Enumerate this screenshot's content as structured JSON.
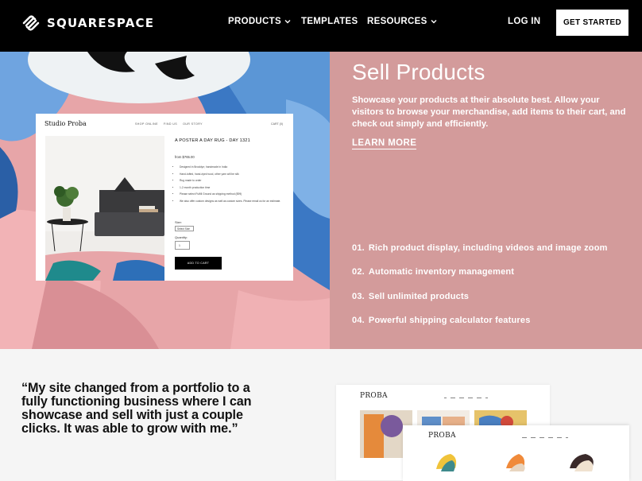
{
  "nav": {
    "logo_text": "SQUARESPACE",
    "products": "PRODUCTS",
    "templates": "TEMPLATES",
    "resources": "RESOURCES",
    "login": "LOG IN",
    "cta": "GET STARTED"
  },
  "hero": {
    "title": "Sell Products",
    "description": "Showcase your products at their absolute best. Allow your visitors to browse your merchandise, add items to their cart, and check out simply and efficiently.",
    "learn_more": "LEARN MORE",
    "features": [
      {
        "num": "01.",
        "text": "Rich product display, including videos and image zoom"
      },
      {
        "num": "02.",
        "text": "Automatic inventory management"
      },
      {
        "num": "03.",
        "text": "Sell unlimited products"
      },
      {
        "num": "04.",
        "text": "Powerful shipping calculator features"
      }
    ]
  },
  "mock": {
    "brand": "Studio Proba",
    "nav": [
      "SHOP ONLINE",
      "FIND US",
      "OUR STORY"
    ],
    "cart": "CART (0)",
    "product_title": "A POSTER A DAY RUG - DAY 1321",
    "price": "from $765.00",
    "bullets": [
      "Designed in Brooklyn; handmade in India",
      "Hand-tufted, hand-dyed wool, other yarn will be silk",
      "Rug made to order",
      "1-2 month production time",
      "Please select Fulfill Ground as shipping method ($99)",
      "We also offer custom designs as well as custom sizes. Please email us for an estimate."
    ],
    "size_label": "Size:",
    "size_value": "Select Size",
    "qty_label": "Quantity:",
    "qty_value": "1",
    "add_button": "ADD TO CART"
  },
  "testimonial": {
    "quote": "“My site changed from a portfolio to a fully functioning business where I can showcase and sell with just a couple clicks. It was able to grow with me.”"
  },
  "shots": {
    "brand": "PROBA"
  },
  "colors": {
    "nav_bg": "#000000",
    "panel_bg": "#d39b9b",
    "page_bg": "#f5f5f5"
  }
}
